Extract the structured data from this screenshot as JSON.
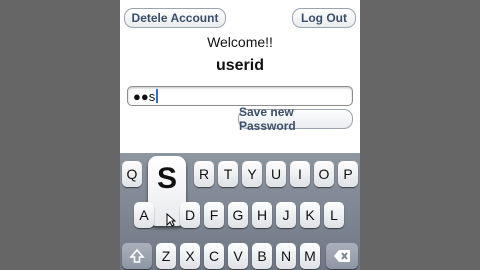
{
  "header": {
    "delete_label": "Detele Account",
    "logout_label": "Log Out"
  },
  "main": {
    "welcome": "Welcome!!",
    "username": "userid",
    "password_value": "●●s",
    "save_label": "Save new Password"
  },
  "keyboard": {
    "row1": [
      "Q",
      "S",
      "R",
      "T",
      "Y",
      "U",
      "I",
      "O",
      "P"
    ],
    "row2": [
      "A",
      "D",
      "F",
      "G",
      "H",
      "J",
      "K",
      "L"
    ],
    "row3": [
      "Z",
      "X",
      "C",
      "V",
      "B",
      "N",
      "M"
    ],
    "popup_key": "S",
    "shift_icon": "shift-icon",
    "backspace_icon": "backspace-icon"
  }
}
